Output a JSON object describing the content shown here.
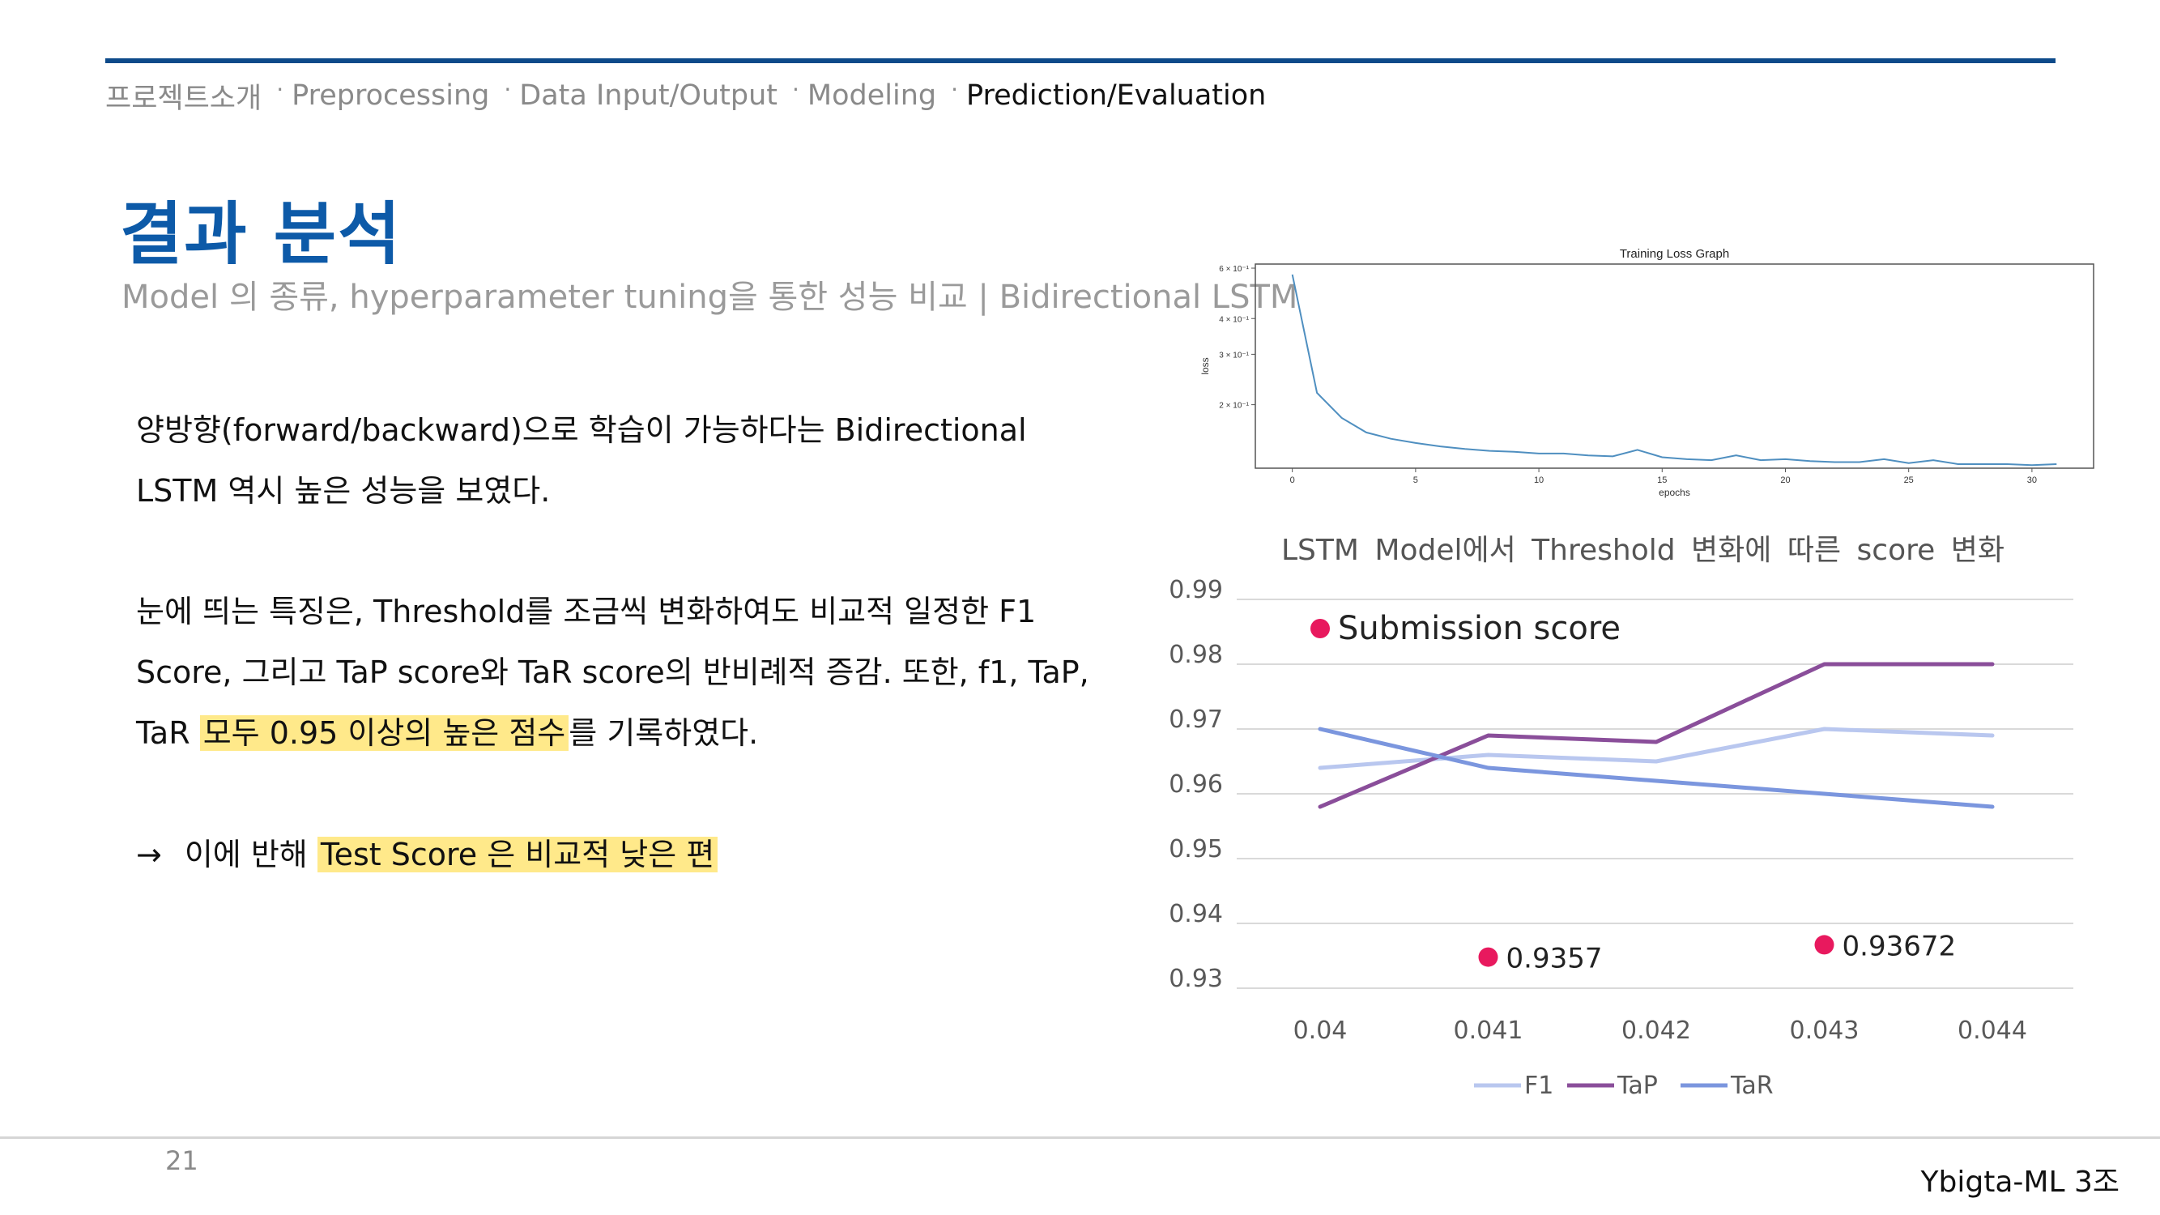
{
  "nav": {
    "items": [
      {
        "label": "프로젝트소개",
        "active": false
      },
      {
        "label": "Preprocessing",
        "active": false
      },
      {
        "label": "Data Input/Output",
        "active": false
      },
      {
        "label": "Modeling",
        "active": false
      },
      {
        "label": "Prediction/Evaluation",
        "active": true
      }
    ],
    "separator": "·"
  },
  "title": "결과 분석",
  "subtitle": "Model 의 종류, hyperparameter tuning을 통한 성능 비교 | Bidirectional LSTM",
  "body": {
    "p1": "양방향(forward/backward)으로 학습이 가능하다는 Bidirectional LSTM 역시 높은 성능을 보였다.",
    "p2_a": "눈에 띄는 특징은, Threshold를 조금씩 변화하여도 비교적 일정한 F1 Score, 그리고 TaP score와 TaR score의 반비례적 증감. 또한, f1, TaP, TaR ",
    "p2_hl": "모두 0.95 이상의 높은 점수",
    "p2_b": "를 기록하였다.",
    "p3_arrow": "→",
    "p3_a": "이에 반해 ",
    "p3_hl": "Test Score 은 비교적 낮은 편"
  },
  "footer": {
    "page": "21",
    "team": "Ybigta-ML 3조"
  },
  "chart_data": [
    {
      "type": "line",
      "title": "Training Loss Graph",
      "xlabel": "epochs",
      "ylabel": "loss",
      "y_scale": "log",
      "x_ticks": [
        "0",
        "5",
        "10",
        "15",
        "20",
        "25",
        "30"
      ],
      "y_ticks": [
        "2 × 10⁻¹",
        "3 × 10⁻¹",
        "4 × 10⁻¹",
        "6 × 10⁻¹"
      ],
      "xlim": [
        -1.5,
        32.5
      ],
      "ylim": [
        0.12,
        0.62
      ],
      "color": "#4f8fc0",
      "x": [
        0,
        1,
        2,
        3,
        4,
        5,
        6,
        7,
        8,
        9,
        10,
        11,
        12,
        13,
        14,
        15,
        16,
        17,
        18,
        19,
        20,
        21,
        22,
        23,
        24,
        25,
        26,
        27,
        28,
        29,
        30,
        31
      ],
      "y": [
        0.57,
        0.22,
        0.18,
        0.16,
        0.152,
        0.147,
        0.143,
        0.14,
        0.138,
        0.137,
        0.135,
        0.135,
        0.133,
        0.132,
        0.139,
        0.131,
        0.129,
        0.128,
        0.133,
        0.128,
        0.129,
        0.127,
        0.126,
        0.126,
        0.129,
        0.125,
        0.128,
        0.124,
        0.124,
        0.124,
        0.123,
        0.124
      ]
    },
    {
      "type": "line",
      "title": "LSTM Model에서 Threshold 변화에 따른 score 변화",
      "categories": [
        "0.04",
        "0.041",
        "0.042",
        "0.043",
        "0.044"
      ],
      "ylim": [
        0.93,
        0.99
      ],
      "y_ticks": [
        "0.93",
        "0.94",
        "0.95",
        "0.96",
        "0.97",
        "0.98",
        "0.99"
      ],
      "grid": true,
      "legend": "bottom",
      "series": [
        {
          "name": "F1",
          "color": "#b9c7ef",
          "values": [
            0.964,
            0.966,
            0.965,
            0.97,
            0.969
          ]
        },
        {
          "name": "TaP",
          "color": "#8a4e9a",
          "values": [
            0.958,
            0.969,
            0.968,
            0.98,
            0.98
          ]
        },
        {
          "name": "TaR",
          "color": "#7b96de",
          "values": [
            0.97,
            0.964,
            0.962,
            0.96,
            0.958
          ]
        }
      ],
      "annotations": [
        {
          "label": "Submission score",
          "x": 0.04,
          "y": 0.9855,
          "color": "#e8195e"
        },
        {
          "label": "0.9357",
          "x": 0.041,
          "y": 0.9348,
          "color": "#e8195e"
        },
        {
          "label": "0.93672",
          "x": 0.043,
          "y": 0.9367,
          "color": "#e8195e"
        }
      ]
    }
  ]
}
